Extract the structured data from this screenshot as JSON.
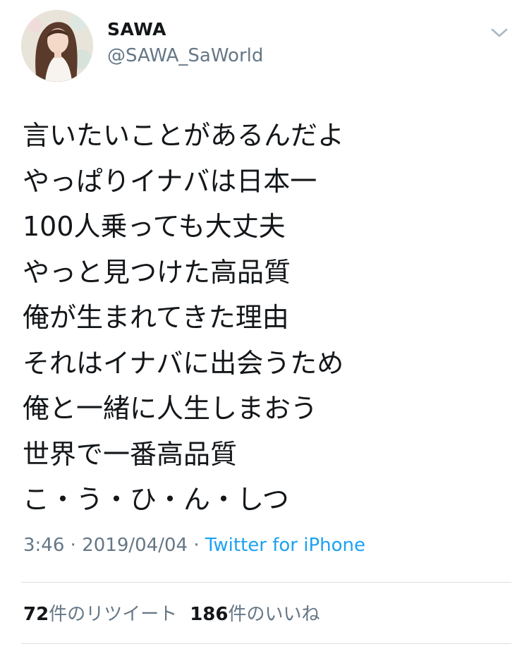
{
  "user": {
    "name": "SAWA",
    "handle": "@SAWA_SaWorld"
  },
  "icons": {
    "menu": "chevron-down-icon"
  },
  "tweet": {
    "lines": [
      "言いたいことがあるんだよ",
      "やっぱりイナバは日本一",
      "100人乗っても大丈夫",
      "やっと見つけた高品質",
      "俺が生まれてきた理由",
      "それはイナバに出会うため",
      "俺と一緒に人生しまおう",
      "世界で一番高品質",
      "こ・う・ひ・ん・しつ"
    ]
  },
  "meta": {
    "time": "3:46",
    "separator": "·",
    "date": "2019/04/04",
    "source": "Twitter for iPhone"
  },
  "stats": {
    "retweets_count": "72",
    "retweets_label": "件のリツイート",
    "likes_count": "186",
    "likes_label": "件のいいね"
  },
  "colors": {
    "text": "#14171a",
    "secondary": "#657786",
    "link": "#1da1f2",
    "divider": "#d9dfe3"
  }
}
